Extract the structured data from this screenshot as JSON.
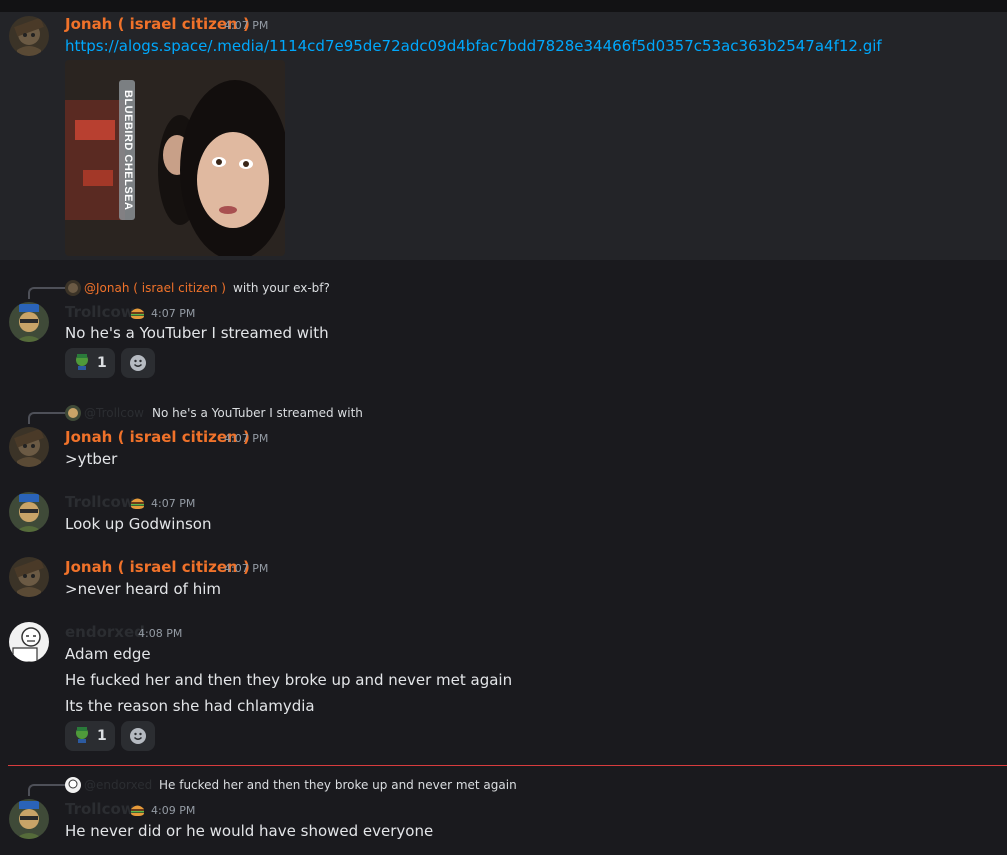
{
  "colors": {
    "accent_name": "#f0722a",
    "link": "#00a8fc",
    "new_divider": "#d83c3e"
  },
  "m1": {
    "author": "Jonah ( israel citizen )",
    "time": "4:07 PM",
    "link": "https://alogs.space/.media/1114cd7e95de72adc09d4bfac7bdd7828e34466f5d0357c53ac363b2547a4f12.gif",
    "gif_caption": "BLUEBIRD CHELSEA"
  },
  "m2": {
    "reply_author": "@Jonah ( israel citizen )",
    "reply_text": "with your ex-bf?",
    "author": "Trollcow",
    "time": "4:07 PM",
    "text": "No he's a YouTuber I streamed with",
    "reaction_count": "1"
  },
  "m3": {
    "reply_author": "@Trollcow",
    "reply_text": "No he's a YouTuber I streamed with",
    "author": "Jonah ( israel citizen )",
    "time": "4:07 PM",
    "text": ">ytber"
  },
  "m4": {
    "author": "Trollcow",
    "time": "4:07 PM",
    "text": "Look up Godwinson"
  },
  "m5": {
    "author": "Jonah ( israel citizen )",
    "time": "4:07 PM",
    "text": ">never heard of him"
  },
  "m6": {
    "author": "endorxed",
    "time": "4:08 PM",
    "lines": [
      "Adam edge",
      "He fucked her and then they broke up and never met again",
      "Its the reason she had chlamydia"
    ],
    "reaction_count": "1"
  },
  "m7": {
    "reply_author": "@endorxed",
    "reply_text": "He fucked her and then they broke up and never met again",
    "author": "Trollcow",
    "time": "4:09 PM",
    "text": "He never did or he would have showed everyone"
  }
}
